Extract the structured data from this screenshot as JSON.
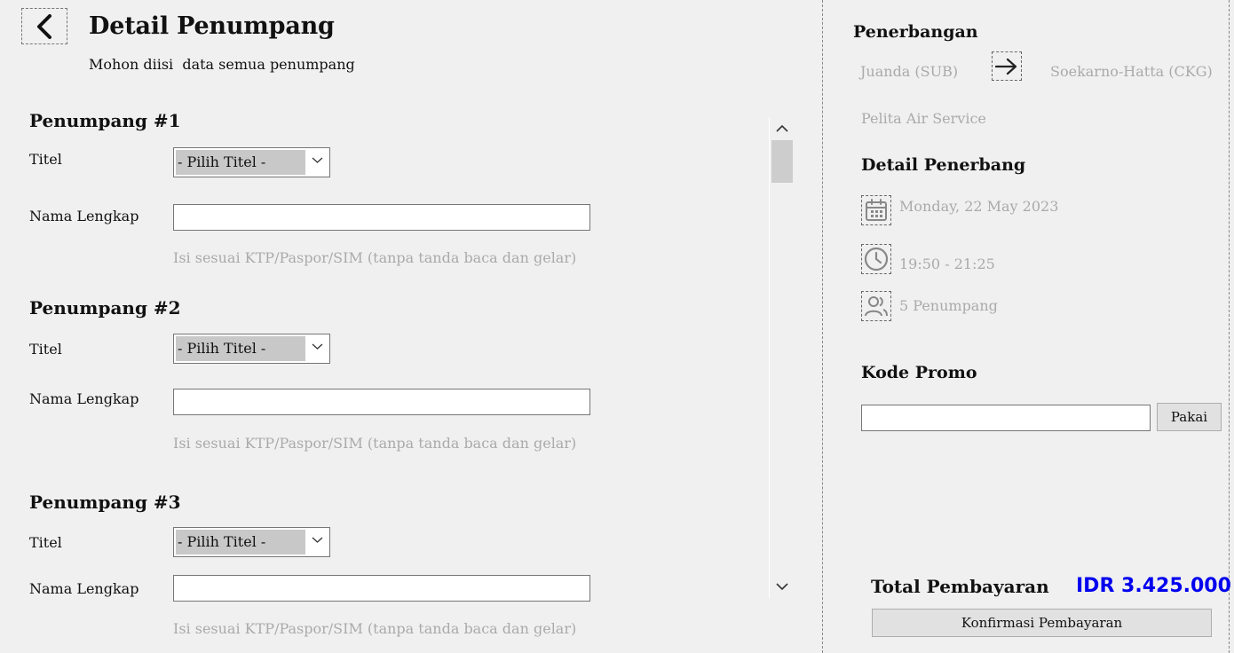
{
  "header": {
    "title": "Detail Penumpang",
    "subtitle": "Mohon diisi  data semua penumpang"
  },
  "passengers": [
    {
      "heading": "Penumpang #1",
      "title_label": "Titel",
      "title_value": "- Pilih Titel -",
      "name_label": "Nama Lengkap",
      "name_value": "",
      "hint": "Isi sesuai KTP/Paspor/SIM (tanpa tanda baca dan gelar)"
    },
    {
      "heading": "Penumpang #2",
      "title_label": "Titel",
      "title_value": "- Pilih Titel -",
      "name_label": "Nama Lengkap",
      "name_value": "",
      "hint": "Isi sesuai KTP/Paspor/SIM (tanpa tanda baca dan gelar)"
    },
    {
      "heading": "Penumpang #3",
      "title_label": "Titel",
      "title_value": "- Pilih Titel -",
      "name_label": "Nama Lengkap",
      "name_value": "",
      "hint": "Isi sesuai KTP/Paspor/SIM (tanpa tanda baca dan gelar)"
    }
  ],
  "flight": {
    "section_title": "Penerbangan",
    "origin": "Juanda (SUB)",
    "destination": "Soekarno-Hatta (CKG)",
    "airline": "Pelita Air Service",
    "arrow_icon": "arrow-right-icon"
  },
  "details": {
    "section_title": "Detail Penerbang",
    "date": "Monday, 22 May 2023",
    "time": "19:50 - 21:25",
    "passengers": "5 Penumpang",
    "icons": [
      "calendar-icon",
      "clock-icon",
      "users-icon"
    ]
  },
  "promo": {
    "section_title": "Kode Promo",
    "input_value": "",
    "apply_label": "Pakai"
  },
  "payment": {
    "total_label": "Total Pembayaran",
    "total_value": "IDR 3.425.000",
    "confirm_label": "Konfirmasi Pembayaran",
    "accent_color": "#0000ee"
  }
}
